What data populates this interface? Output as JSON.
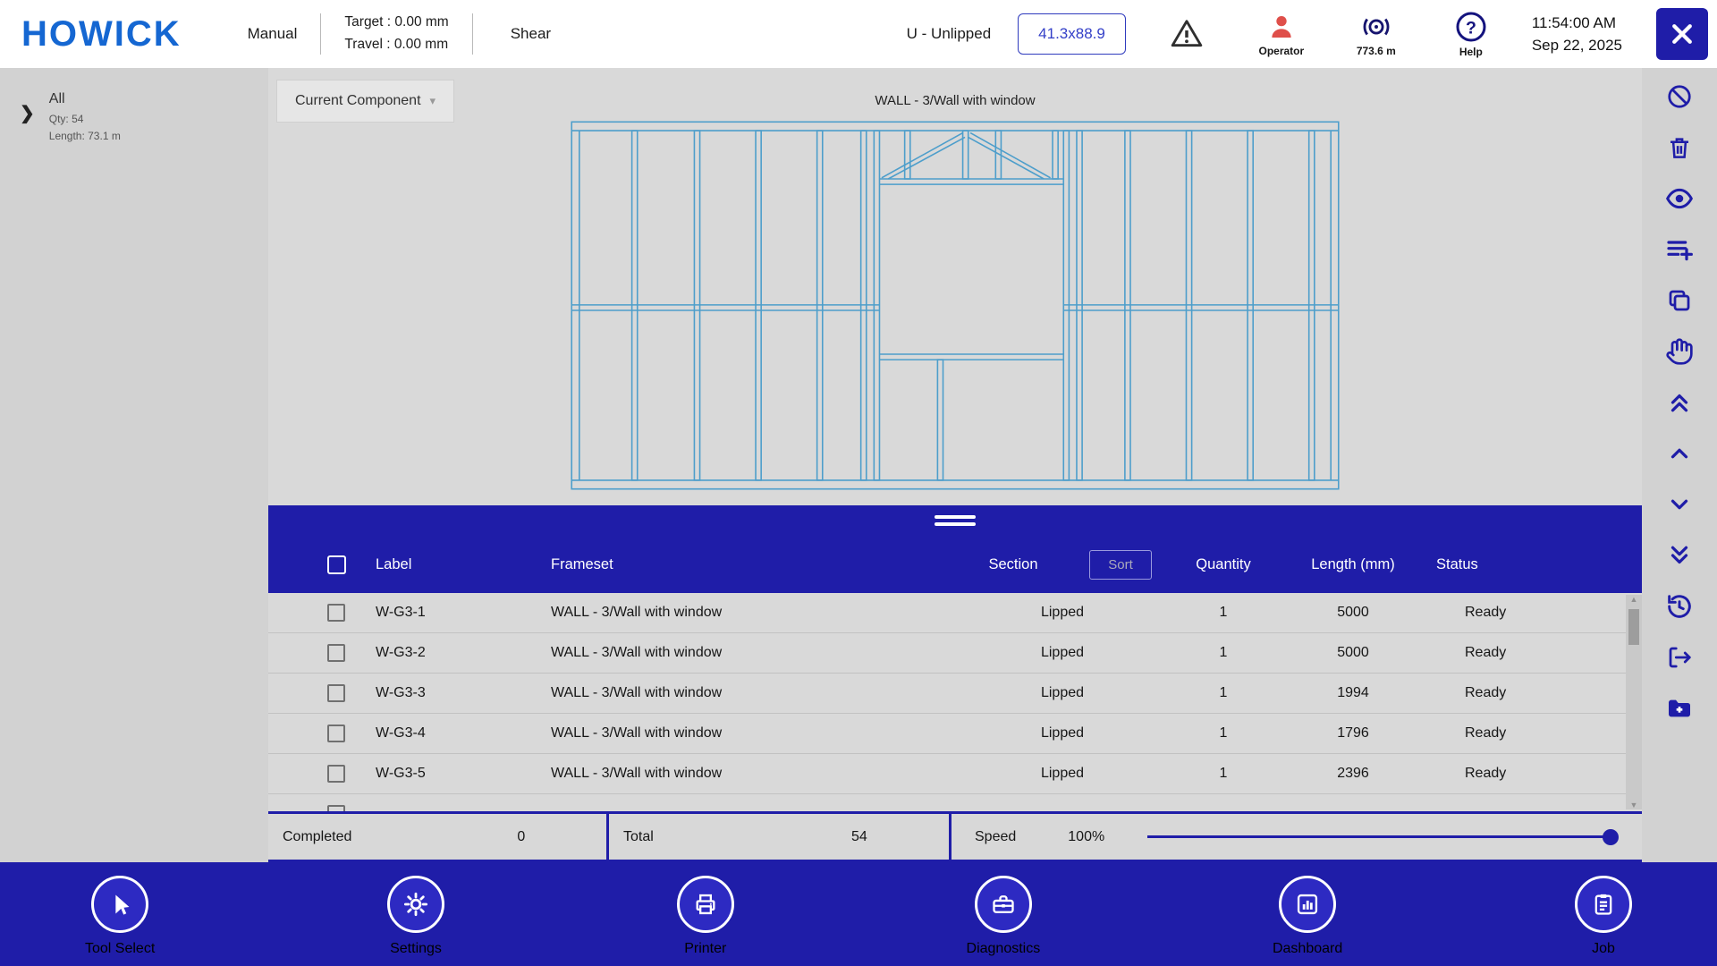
{
  "header": {
    "logo": "HOWICK",
    "mode": "Manual",
    "target": "Target : 0.00 mm",
    "travel": "Travel : 0.00 mm",
    "tool": "Shear",
    "profile": "U - Unlipped",
    "size": "41.3x88.9",
    "operator_label": "Operator",
    "coil_remaining": "773.6 m",
    "help_label": "Help",
    "time": "11:54:00 AM",
    "date": "Sep 22, 2025"
  },
  "left_panel": {
    "title": "All",
    "qty": "Qty: 54",
    "length": "Length: 73.1 m"
  },
  "viewer": {
    "dropdown": "Current Component",
    "component_title": "WALL - 3/Wall with window"
  },
  "table": {
    "headers": {
      "label": "Label",
      "frameset": "Frameset",
      "section": "Section",
      "sort": "Sort",
      "quantity": "Quantity",
      "length": "Length (mm)",
      "status": "Status"
    },
    "rows": [
      {
        "label": "W-G3-1",
        "frameset": "WALL - 3/Wall with window",
        "section": "Lipped",
        "quantity": "1",
        "length": "5000",
        "status": "Ready"
      },
      {
        "label": "W-G3-2",
        "frameset": "WALL - 3/Wall with window",
        "section": "Lipped",
        "quantity": "1",
        "length": "5000",
        "status": "Ready"
      },
      {
        "label": "W-G3-3",
        "frameset": "WALL - 3/Wall with window",
        "section": "Lipped",
        "quantity": "1",
        "length": "1994",
        "status": "Ready"
      },
      {
        "label": "W-G3-4",
        "frameset": "WALL - 3/Wall with window",
        "section": "Lipped",
        "quantity": "1",
        "length": "1796",
        "status": "Ready"
      },
      {
        "label": "W-G3-5",
        "frameset": "WALL - 3/Wall with window",
        "section": "Lipped",
        "quantity": "1",
        "length": "2396",
        "status": "Ready"
      }
    ]
  },
  "footer": {
    "completed_label": "Completed",
    "completed": "0",
    "total_label": "Total",
    "total": "54",
    "speed_label": "Speed",
    "speed": "100%"
  },
  "nav": {
    "items": [
      {
        "label": "Tool Select"
      },
      {
        "label": "Settings"
      },
      {
        "label": "Printer"
      },
      {
        "label": "Diagnostics"
      },
      {
        "label": "Dashboard"
      },
      {
        "label": "Job"
      }
    ]
  },
  "colors": {
    "accent": "#1f1da8",
    "drawing_line": "#4d9ecb",
    "operator": "#df4f4a"
  }
}
